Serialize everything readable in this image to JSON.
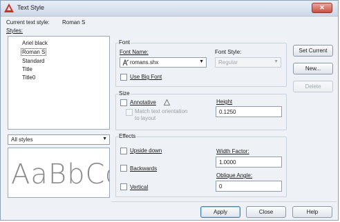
{
  "window": {
    "title": "Text Style",
    "close_glyph": "✕",
    "accent_color": "#c9503f"
  },
  "current_style": {
    "label": "Current text style:",
    "value": "Roman S"
  },
  "styles": {
    "label": "Styles:",
    "items": [
      {
        "label": "Ariel black",
        "selected": false
      },
      {
        "label": "Roman S",
        "selected": true
      },
      {
        "label": "Standard",
        "selected": false
      },
      {
        "label": "Title",
        "selected": false
      },
      {
        "label": "Title0",
        "selected": false
      }
    ],
    "filter_value": "All styles"
  },
  "preview": {
    "text": "AaBbCc"
  },
  "font": {
    "group_title": "Font",
    "font_name_label": "Font Name:",
    "font_name_value": "romans.shx",
    "font_style_label": "Font Style:",
    "font_style_value": "Regular",
    "big_font_label": "Use Big Font",
    "big_font_checked": false
  },
  "size": {
    "group_title": "Size",
    "annotative_label": "Annotative",
    "annotative_checked": false,
    "match_label_line1": "Match text orientation",
    "match_label_line2": "to layout",
    "height_label": "Height",
    "height_value": "0.1250"
  },
  "effects": {
    "group_title": "Effects",
    "upside_down_label": "Upside down",
    "backwards_label": "Backwards",
    "vertical_label": "Vertical",
    "width_factor_label": "Width Factor:",
    "width_factor_value": "1.0000",
    "oblique_label": "Oblique Angle:",
    "oblique_value": "0"
  },
  "side_buttons": {
    "set_current": "Set Current",
    "new": "New...",
    "delete": "Delete"
  },
  "footer_buttons": {
    "apply": "Apply",
    "close": "Close",
    "help": "Help"
  }
}
